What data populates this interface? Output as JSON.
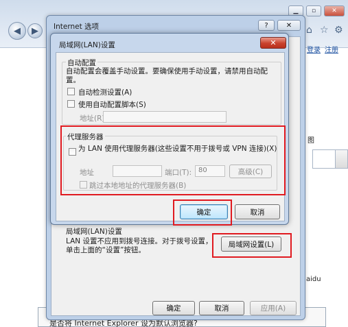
{
  "browser": {
    "toolbar": {
      "login_link": "登录",
      "register_link": "注册"
    },
    "side_links": {
      "link_tu": "图",
      "link_aidu": "aidu"
    },
    "bottom_strip_text": "是否将 Internet Explorer 设为默认浏览器?"
  },
  "internet_options": {
    "title": "Internet 选项",
    "help_label": "?",
    "close_label": "✕",
    "lan_section": {
      "title": "局域网(LAN)设置",
      "description": "LAN 设置不应用到拨号连接。对于拨号设置，单击上面的“设置”按钮。",
      "settings_button": "局域网设置(L)"
    },
    "buttons": {
      "ok": "确定",
      "cancel": "取消",
      "apply": "应用(A)"
    }
  },
  "lan_dialog": {
    "title": "局域网(LAN)设置",
    "close_label": "✕",
    "auto_config": {
      "group_title": "自动配置",
      "description": "自动配置会覆盖手动设置。要确保使用手动设置，请禁用自动配置。",
      "auto_detect_label": "自动检测设置(A)",
      "auto_detect_checked": false,
      "use_script_label": "使用自动配置脚本(S)",
      "use_script_checked": false,
      "address_label": "地址(R)",
      "address_value": ""
    },
    "proxy": {
      "group_title": "代理服务器",
      "use_proxy_label": "为 LAN 使用代理服务器(这些设置不用于拨号或 VPN 连接)(X)",
      "use_proxy_checked": false,
      "address_label": "地址",
      "address_value": "",
      "port_label": "端口(T):",
      "port_value": "80",
      "advanced_button": "高级(C)",
      "bypass_label": "跳过本地地址的代理服务器(B)",
      "bypass_checked": false
    },
    "buttons": {
      "ok": "确定",
      "cancel": "取消"
    }
  },
  "highlight_color": "#e0191f"
}
